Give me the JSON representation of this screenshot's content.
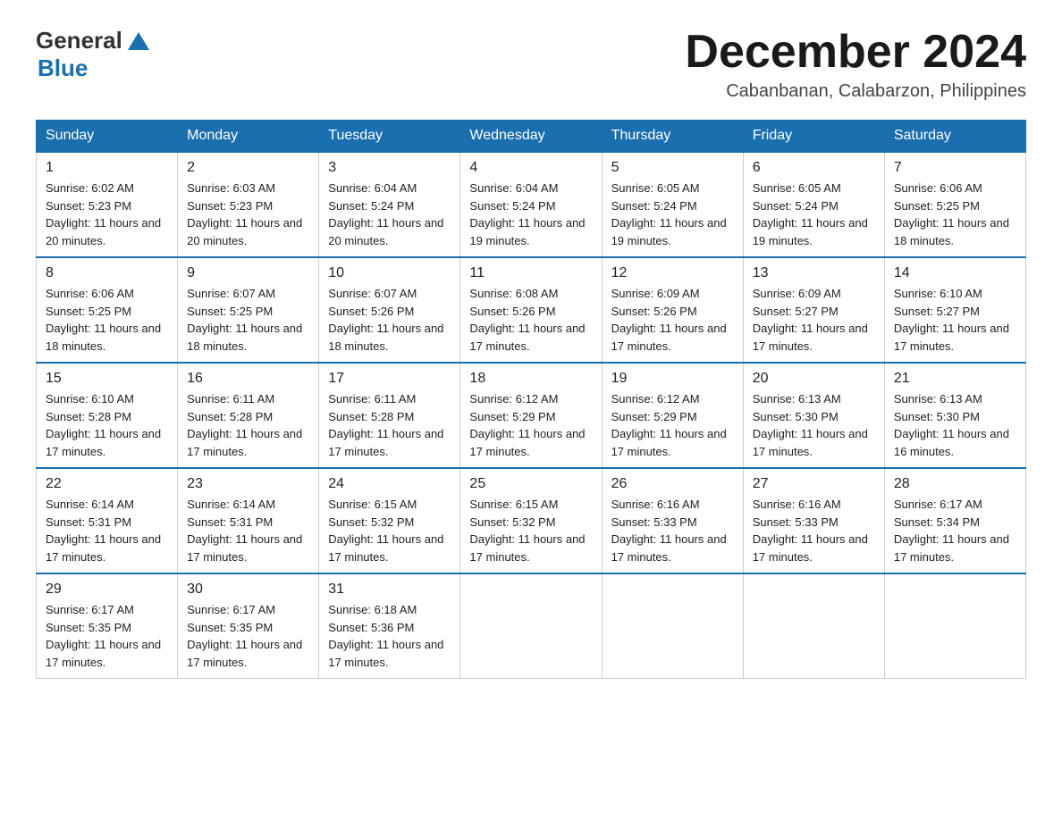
{
  "header": {
    "logo_general": "General",
    "logo_blue": "Blue",
    "main_title": "December 2024",
    "subtitle": "Cabanbanan, Calabarzon, Philippines"
  },
  "calendar": {
    "days_of_week": [
      "Sunday",
      "Monday",
      "Tuesday",
      "Wednesday",
      "Thursday",
      "Friday",
      "Saturday"
    ],
    "weeks": [
      [
        {
          "day": "1",
          "sunrise": "Sunrise: 6:02 AM",
          "sunset": "Sunset: 5:23 PM",
          "daylight": "Daylight: 11 hours and 20 minutes."
        },
        {
          "day": "2",
          "sunrise": "Sunrise: 6:03 AM",
          "sunset": "Sunset: 5:23 PM",
          "daylight": "Daylight: 11 hours and 20 minutes."
        },
        {
          "day": "3",
          "sunrise": "Sunrise: 6:04 AM",
          "sunset": "Sunset: 5:24 PM",
          "daylight": "Daylight: 11 hours and 20 minutes."
        },
        {
          "day": "4",
          "sunrise": "Sunrise: 6:04 AM",
          "sunset": "Sunset: 5:24 PM",
          "daylight": "Daylight: 11 hours and 19 minutes."
        },
        {
          "day": "5",
          "sunrise": "Sunrise: 6:05 AM",
          "sunset": "Sunset: 5:24 PM",
          "daylight": "Daylight: 11 hours and 19 minutes."
        },
        {
          "day": "6",
          "sunrise": "Sunrise: 6:05 AM",
          "sunset": "Sunset: 5:24 PM",
          "daylight": "Daylight: 11 hours and 19 minutes."
        },
        {
          "day": "7",
          "sunrise": "Sunrise: 6:06 AM",
          "sunset": "Sunset: 5:25 PM",
          "daylight": "Daylight: 11 hours and 18 minutes."
        }
      ],
      [
        {
          "day": "8",
          "sunrise": "Sunrise: 6:06 AM",
          "sunset": "Sunset: 5:25 PM",
          "daylight": "Daylight: 11 hours and 18 minutes."
        },
        {
          "day": "9",
          "sunrise": "Sunrise: 6:07 AM",
          "sunset": "Sunset: 5:25 PM",
          "daylight": "Daylight: 11 hours and 18 minutes."
        },
        {
          "day": "10",
          "sunrise": "Sunrise: 6:07 AM",
          "sunset": "Sunset: 5:26 PM",
          "daylight": "Daylight: 11 hours and 18 minutes."
        },
        {
          "day": "11",
          "sunrise": "Sunrise: 6:08 AM",
          "sunset": "Sunset: 5:26 PM",
          "daylight": "Daylight: 11 hours and 17 minutes."
        },
        {
          "day": "12",
          "sunrise": "Sunrise: 6:09 AM",
          "sunset": "Sunset: 5:26 PM",
          "daylight": "Daylight: 11 hours and 17 minutes."
        },
        {
          "day": "13",
          "sunrise": "Sunrise: 6:09 AM",
          "sunset": "Sunset: 5:27 PM",
          "daylight": "Daylight: 11 hours and 17 minutes."
        },
        {
          "day": "14",
          "sunrise": "Sunrise: 6:10 AM",
          "sunset": "Sunset: 5:27 PM",
          "daylight": "Daylight: 11 hours and 17 minutes."
        }
      ],
      [
        {
          "day": "15",
          "sunrise": "Sunrise: 6:10 AM",
          "sunset": "Sunset: 5:28 PM",
          "daylight": "Daylight: 11 hours and 17 minutes."
        },
        {
          "day": "16",
          "sunrise": "Sunrise: 6:11 AM",
          "sunset": "Sunset: 5:28 PM",
          "daylight": "Daylight: 11 hours and 17 minutes."
        },
        {
          "day": "17",
          "sunrise": "Sunrise: 6:11 AM",
          "sunset": "Sunset: 5:28 PM",
          "daylight": "Daylight: 11 hours and 17 minutes."
        },
        {
          "day": "18",
          "sunrise": "Sunrise: 6:12 AM",
          "sunset": "Sunset: 5:29 PM",
          "daylight": "Daylight: 11 hours and 17 minutes."
        },
        {
          "day": "19",
          "sunrise": "Sunrise: 6:12 AM",
          "sunset": "Sunset: 5:29 PM",
          "daylight": "Daylight: 11 hours and 17 minutes."
        },
        {
          "day": "20",
          "sunrise": "Sunrise: 6:13 AM",
          "sunset": "Sunset: 5:30 PM",
          "daylight": "Daylight: 11 hours and 17 minutes."
        },
        {
          "day": "21",
          "sunrise": "Sunrise: 6:13 AM",
          "sunset": "Sunset: 5:30 PM",
          "daylight": "Daylight: 11 hours and 16 minutes."
        }
      ],
      [
        {
          "day": "22",
          "sunrise": "Sunrise: 6:14 AM",
          "sunset": "Sunset: 5:31 PM",
          "daylight": "Daylight: 11 hours and 17 minutes."
        },
        {
          "day": "23",
          "sunrise": "Sunrise: 6:14 AM",
          "sunset": "Sunset: 5:31 PM",
          "daylight": "Daylight: 11 hours and 17 minutes."
        },
        {
          "day": "24",
          "sunrise": "Sunrise: 6:15 AM",
          "sunset": "Sunset: 5:32 PM",
          "daylight": "Daylight: 11 hours and 17 minutes."
        },
        {
          "day": "25",
          "sunrise": "Sunrise: 6:15 AM",
          "sunset": "Sunset: 5:32 PM",
          "daylight": "Daylight: 11 hours and 17 minutes."
        },
        {
          "day": "26",
          "sunrise": "Sunrise: 6:16 AM",
          "sunset": "Sunset: 5:33 PM",
          "daylight": "Daylight: 11 hours and 17 minutes."
        },
        {
          "day": "27",
          "sunrise": "Sunrise: 6:16 AM",
          "sunset": "Sunset: 5:33 PM",
          "daylight": "Daylight: 11 hours and 17 minutes."
        },
        {
          "day": "28",
          "sunrise": "Sunrise: 6:17 AM",
          "sunset": "Sunset: 5:34 PM",
          "daylight": "Daylight: 11 hours and 17 minutes."
        }
      ],
      [
        {
          "day": "29",
          "sunrise": "Sunrise: 6:17 AM",
          "sunset": "Sunset: 5:35 PM",
          "daylight": "Daylight: 11 hours and 17 minutes."
        },
        {
          "day": "30",
          "sunrise": "Sunrise: 6:17 AM",
          "sunset": "Sunset: 5:35 PM",
          "daylight": "Daylight: 11 hours and 17 minutes."
        },
        {
          "day": "31",
          "sunrise": "Sunrise: 6:18 AM",
          "sunset": "Sunset: 5:36 PM",
          "daylight": "Daylight: 11 hours and 17 minutes."
        },
        null,
        null,
        null,
        null
      ]
    ]
  }
}
